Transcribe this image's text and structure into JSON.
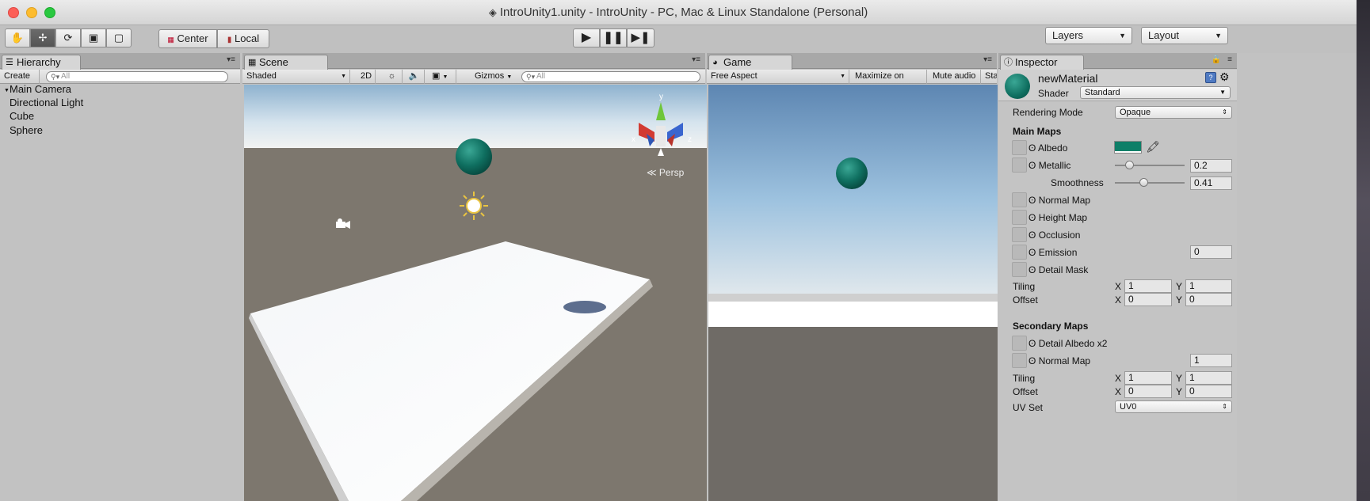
{
  "window": {
    "title": "IntroUnity1.unity - IntroUnity - PC, Mac & Linux Standalone (Personal)"
  },
  "toolbar": {
    "pivot_label": "Center",
    "space_label": "Local",
    "layers_label": "Layers",
    "layout_label": "Layout"
  },
  "hierarchy": {
    "tab": "Hierarchy",
    "create": "Create",
    "search_placeholder": "All",
    "items": [
      "Main Camera",
      "Directional Light",
      "Cube",
      "Sphere"
    ]
  },
  "scene": {
    "tab": "Scene",
    "shading": "Shaded",
    "mode_2d": "2D",
    "gizmos": "Gizmos",
    "search_placeholder": "All",
    "persp_label": "Persp",
    "axis_y": "y",
    "axis_x": "x",
    "axis_z": "z"
  },
  "game": {
    "tab": "Game",
    "aspect": "Free Aspect",
    "maximize": "Maximize on Play",
    "mute": "Mute audio",
    "stats": "Sta"
  },
  "inspector": {
    "tab": "Inspector",
    "material_name": "newMaterial",
    "shader_label": "Shader",
    "shader_value": "Standard",
    "rendering_mode_label": "Rendering Mode",
    "rendering_mode_value": "Opaque",
    "main_maps": "Main Maps",
    "albedo": "Albedo",
    "albedo_color": "#0e7f68",
    "metallic": "Metallic",
    "metallic_value": "0.2",
    "smoothness": "Smoothness",
    "smoothness_value": "0.41",
    "normal_map": "Normal Map",
    "height_map": "Height Map",
    "occlusion": "Occlusion",
    "emission": "Emission",
    "emission_value": "0",
    "detail_mask": "Detail Mask",
    "tiling": "Tiling",
    "offset": "Offset",
    "x": "X",
    "y": "Y",
    "main_tiling_x": "1",
    "main_tiling_y": "1",
    "main_offset_x": "0",
    "main_offset_y": "0",
    "secondary_maps": "Secondary Maps",
    "detail_albedo": "Detail Albedo x2",
    "sec_normal_map": "Normal Map",
    "sec_normal_value": "1",
    "sec_tiling_x": "1",
    "sec_tiling_y": "1",
    "sec_offset_x": "0",
    "sec_offset_y": "0",
    "uv_set": "UV Set",
    "uv_set_value": "UV0"
  }
}
